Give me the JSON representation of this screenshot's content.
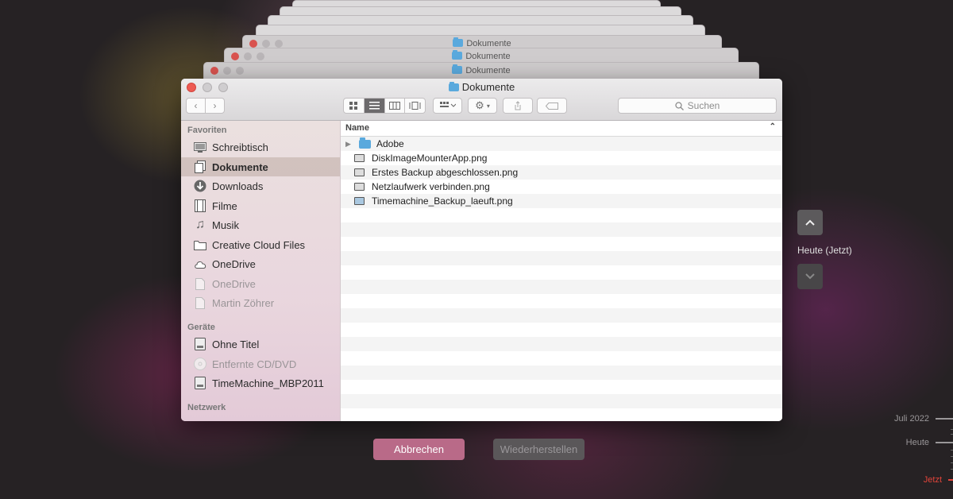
{
  "stack_title": "Dokumente",
  "window": {
    "title": "Dokumente",
    "nav": {
      "back": "‹",
      "forward": "›"
    },
    "search_placeholder": "Suchen"
  },
  "sidebar": {
    "favorites_heading": "Favoriten",
    "favorites": [
      {
        "label": "Schreibtisch",
        "icon": "desktop-icon"
      },
      {
        "label": "Dokumente",
        "icon": "documents-icon",
        "selected": true
      },
      {
        "label": "Downloads",
        "icon": "downloads-icon"
      },
      {
        "label": "Filme",
        "icon": "movies-icon"
      },
      {
        "label": "Musik",
        "icon": "music-icon"
      },
      {
        "label": "Creative Cloud Files",
        "icon": "folder-icon"
      },
      {
        "label": "OneDrive",
        "icon": "cloud-icon"
      },
      {
        "label": "OneDrive",
        "icon": "document-icon",
        "dimmed": true
      },
      {
        "label": "Martin Zöhrer",
        "icon": "document-icon",
        "dimmed": true
      }
    ],
    "devices_heading": "Geräte",
    "devices": [
      {
        "label": "Ohne Titel",
        "icon": "drive-icon"
      },
      {
        "label": "Entfernte CD/DVD",
        "icon": "disc-icon",
        "dimmed": true
      },
      {
        "label": "TimeMachine_MBP2011",
        "icon": "drive-icon"
      }
    ],
    "network_heading": "Netzwerk"
  },
  "list": {
    "column_name": "Name",
    "rows": [
      {
        "name": "Adobe",
        "type": "folder"
      },
      {
        "name": "DiskImageMounterApp.png",
        "type": "file"
      },
      {
        "name": "Erstes Backup abgeschlossen.png",
        "type": "file"
      },
      {
        "name": "Netzlaufwerk verbinden.png",
        "type": "file"
      },
      {
        "name": "Timemachine_Backup_laeuft.png",
        "type": "file"
      }
    ]
  },
  "timemachine": {
    "current_label": "Heute (Jetzt)",
    "cancel_label": "Abbrechen",
    "restore_label": "Wiederherstellen",
    "timeline": {
      "july": "Juli 2022",
      "today": "Heute",
      "now": "Jetzt"
    }
  },
  "colors": {
    "accent_now": "#e2443a",
    "cancel_button": "#b96a88",
    "folder": "#5aa9dd"
  }
}
